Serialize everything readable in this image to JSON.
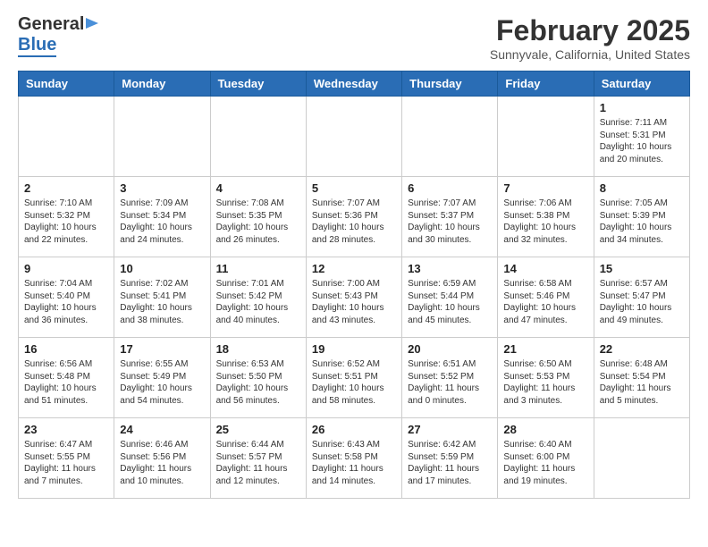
{
  "header": {
    "logo_general": "General",
    "logo_blue": "Blue",
    "month_title": "February 2025",
    "subtitle": "Sunnyvale, California, United States"
  },
  "weekdays": [
    "Sunday",
    "Monday",
    "Tuesday",
    "Wednesday",
    "Thursday",
    "Friday",
    "Saturday"
  ],
  "weeks": [
    [
      {
        "num": "",
        "info": ""
      },
      {
        "num": "",
        "info": ""
      },
      {
        "num": "",
        "info": ""
      },
      {
        "num": "",
        "info": ""
      },
      {
        "num": "",
        "info": ""
      },
      {
        "num": "",
        "info": ""
      },
      {
        "num": "1",
        "info": "Sunrise: 7:11 AM\nSunset: 5:31 PM\nDaylight: 10 hours and 20 minutes."
      }
    ],
    [
      {
        "num": "2",
        "info": "Sunrise: 7:10 AM\nSunset: 5:32 PM\nDaylight: 10 hours and 22 minutes."
      },
      {
        "num": "3",
        "info": "Sunrise: 7:09 AM\nSunset: 5:34 PM\nDaylight: 10 hours and 24 minutes."
      },
      {
        "num": "4",
        "info": "Sunrise: 7:08 AM\nSunset: 5:35 PM\nDaylight: 10 hours and 26 minutes."
      },
      {
        "num": "5",
        "info": "Sunrise: 7:07 AM\nSunset: 5:36 PM\nDaylight: 10 hours and 28 minutes."
      },
      {
        "num": "6",
        "info": "Sunrise: 7:07 AM\nSunset: 5:37 PM\nDaylight: 10 hours and 30 minutes."
      },
      {
        "num": "7",
        "info": "Sunrise: 7:06 AM\nSunset: 5:38 PM\nDaylight: 10 hours and 32 minutes."
      },
      {
        "num": "8",
        "info": "Sunrise: 7:05 AM\nSunset: 5:39 PM\nDaylight: 10 hours and 34 minutes."
      }
    ],
    [
      {
        "num": "9",
        "info": "Sunrise: 7:04 AM\nSunset: 5:40 PM\nDaylight: 10 hours and 36 minutes."
      },
      {
        "num": "10",
        "info": "Sunrise: 7:02 AM\nSunset: 5:41 PM\nDaylight: 10 hours and 38 minutes."
      },
      {
        "num": "11",
        "info": "Sunrise: 7:01 AM\nSunset: 5:42 PM\nDaylight: 10 hours and 40 minutes."
      },
      {
        "num": "12",
        "info": "Sunrise: 7:00 AM\nSunset: 5:43 PM\nDaylight: 10 hours and 43 minutes."
      },
      {
        "num": "13",
        "info": "Sunrise: 6:59 AM\nSunset: 5:44 PM\nDaylight: 10 hours and 45 minutes."
      },
      {
        "num": "14",
        "info": "Sunrise: 6:58 AM\nSunset: 5:46 PM\nDaylight: 10 hours and 47 minutes."
      },
      {
        "num": "15",
        "info": "Sunrise: 6:57 AM\nSunset: 5:47 PM\nDaylight: 10 hours and 49 minutes."
      }
    ],
    [
      {
        "num": "16",
        "info": "Sunrise: 6:56 AM\nSunset: 5:48 PM\nDaylight: 10 hours and 51 minutes."
      },
      {
        "num": "17",
        "info": "Sunrise: 6:55 AM\nSunset: 5:49 PM\nDaylight: 10 hours and 54 minutes."
      },
      {
        "num": "18",
        "info": "Sunrise: 6:53 AM\nSunset: 5:50 PM\nDaylight: 10 hours and 56 minutes."
      },
      {
        "num": "19",
        "info": "Sunrise: 6:52 AM\nSunset: 5:51 PM\nDaylight: 10 hours and 58 minutes."
      },
      {
        "num": "20",
        "info": "Sunrise: 6:51 AM\nSunset: 5:52 PM\nDaylight: 11 hours and 0 minutes."
      },
      {
        "num": "21",
        "info": "Sunrise: 6:50 AM\nSunset: 5:53 PM\nDaylight: 11 hours and 3 minutes."
      },
      {
        "num": "22",
        "info": "Sunrise: 6:48 AM\nSunset: 5:54 PM\nDaylight: 11 hours and 5 minutes."
      }
    ],
    [
      {
        "num": "23",
        "info": "Sunrise: 6:47 AM\nSunset: 5:55 PM\nDaylight: 11 hours and 7 minutes."
      },
      {
        "num": "24",
        "info": "Sunrise: 6:46 AM\nSunset: 5:56 PM\nDaylight: 11 hours and 10 minutes."
      },
      {
        "num": "25",
        "info": "Sunrise: 6:44 AM\nSunset: 5:57 PM\nDaylight: 11 hours and 12 minutes."
      },
      {
        "num": "26",
        "info": "Sunrise: 6:43 AM\nSunset: 5:58 PM\nDaylight: 11 hours and 14 minutes."
      },
      {
        "num": "27",
        "info": "Sunrise: 6:42 AM\nSunset: 5:59 PM\nDaylight: 11 hours and 17 minutes."
      },
      {
        "num": "28",
        "info": "Sunrise: 6:40 AM\nSunset: 6:00 PM\nDaylight: 11 hours and 19 minutes."
      },
      {
        "num": "",
        "info": ""
      }
    ]
  ]
}
